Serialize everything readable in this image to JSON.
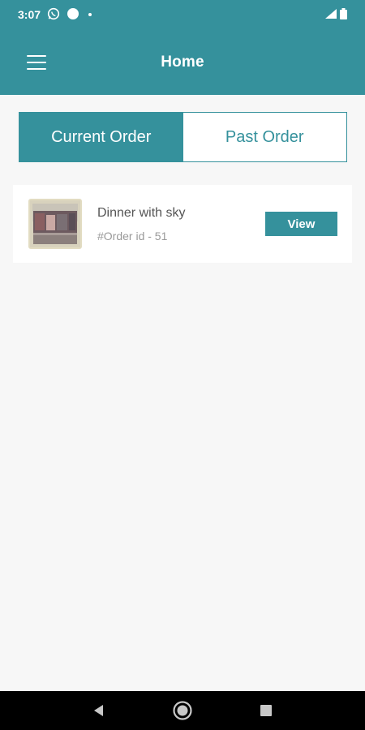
{
  "status_bar": {
    "time": "3:07",
    "icons": [
      "whatsapp-icon",
      "circle-notification-icon",
      "dot-icon",
      "wifi-icon",
      "signal-icon",
      "battery-icon"
    ]
  },
  "app_bar": {
    "title": "Home",
    "menu_icon": "hamburger-menu-icon"
  },
  "tabs": [
    {
      "label": "Current Order",
      "active": true
    },
    {
      "label": "Past Order",
      "active": false
    }
  ],
  "orders": [
    {
      "title": "Dinner with sky",
      "order_id": "#Order id - 51",
      "action_label": "View"
    }
  ],
  "nav_bar": {
    "buttons": [
      "back-icon",
      "home-icon",
      "recents-icon"
    ]
  },
  "colors": {
    "accent": "#35919c",
    "background": "#f7f7f7",
    "card": "#ffffff"
  }
}
